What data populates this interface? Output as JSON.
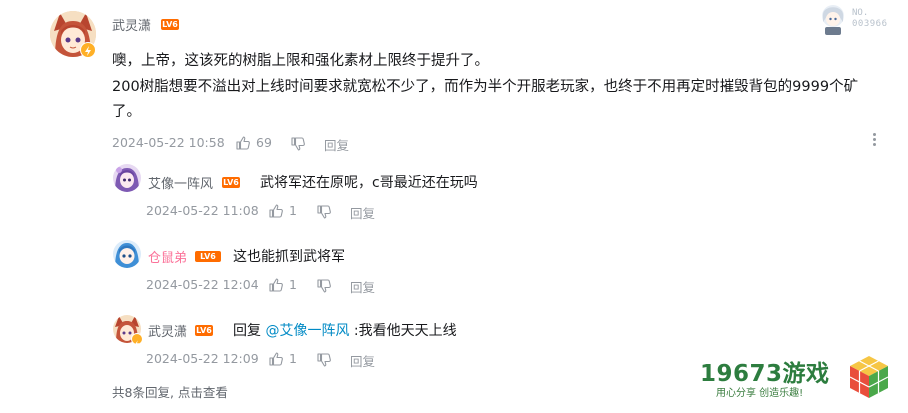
{
  "main_comment": {
    "username": "武灵潇",
    "level": "LV6",
    "text_lines": [
      "噢，上帝，这该死的树脂上限和强化素材上限终于提升了。",
      "200树脂想要不溢出对上线时间要求就宽松不少了，而作为半个开服老玩家，也终于不用再定时摧毁背包的9999个矿",
      "了。"
    ],
    "time": "2024-05-22 10:58",
    "likes": "69",
    "reply_label": "回复"
  },
  "fan_badge": {
    "label": "NO.",
    "number": "003966"
  },
  "replies": [
    {
      "username": "艾像一阵风",
      "level": "LV6",
      "text": "武将军还在原呢，c哥最近还在玩吗",
      "time": "2024-05-22 11:08",
      "likes": "1",
      "reply_label": "回复"
    },
    {
      "username": "仓鼠弟",
      "level": "LV6",
      "text": "这也能抓到武将军",
      "time": "2024-05-22 12:04",
      "likes": "1",
      "reply_label": "回复"
    },
    {
      "username": "武灵潇",
      "level": "LV6",
      "text_prefix": "回复 ",
      "mention": "@艾像一阵风",
      "text_suffix": " :我看他天天上线",
      "time": "2024-05-22 12:09",
      "likes": "1",
      "reply_label": "回复"
    }
  ],
  "footer": {
    "summary": "共8条回复, 点击查看"
  },
  "watermark": {
    "title": "19673游戏",
    "slogan": "用心分享 创造乐趣!"
  },
  "colors": {
    "level_badge": "#ff6c00",
    "mention": "#008ac5",
    "pink_username": "#fb7299",
    "meta_gray": "#9499a0"
  }
}
